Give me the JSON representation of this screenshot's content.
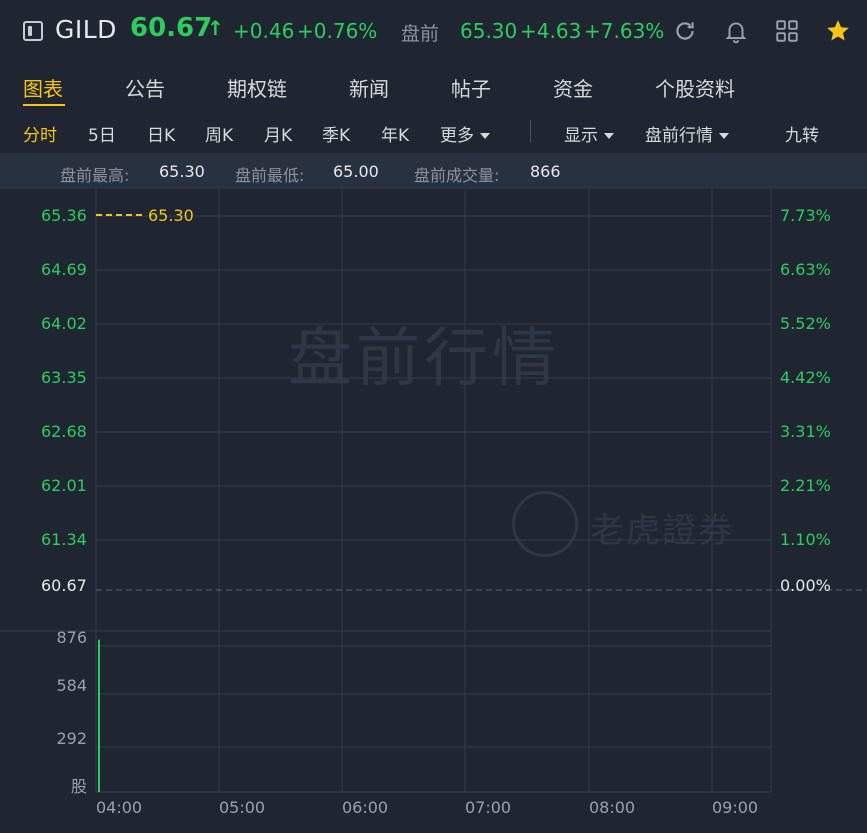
{
  "header": {
    "ticker": "GILD",
    "price": "60.67",
    "arrow": "↑",
    "change": "+0.46",
    "change_pct": "+0.76%",
    "premarket_label": "盘前",
    "premarket_price": "65.30",
    "premarket_change": "+4.63",
    "premarket_pct": "+7.63%",
    "icons": [
      "sidebar-toggle-icon",
      "refresh-icon",
      "bell-icon",
      "grid-icon",
      "star-icon"
    ],
    "accent_color": "#2ecc5e",
    "star_color": "#f5c518"
  },
  "main_tabs": [
    {
      "label": "图表",
      "active": true
    },
    {
      "label": "公告",
      "active": false
    },
    {
      "label": "期权链",
      "active": false
    },
    {
      "label": "新闻",
      "active": false
    },
    {
      "label": "帖子",
      "active": false
    },
    {
      "label": "资金",
      "active": false
    },
    {
      "label": "个股资料",
      "active": false
    }
  ],
  "sub_tabs": {
    "periods": [
      {
        "label": "分时",
        "active": true
      },
      {
        "label": "5日",
        "active": false
      },
      {
        "label": "日K",
        "active": false
      },
      {
        "label": "周K",
        "active": false
      },
      {
        "label": "月K",
        "active": false
      },
      {
        "label": "季K",
        "active": false
      },
      {
        "label": "年K",
        "active": false
      }
    ],
    "more_label": "更多",
    "display_label": "显示",
    "premarket_quote_label": "盘前行情",
    "nine_turn_label": "九转"
  },
  "stats": {
    "high_label": "盘前最高:",
    "high_value": "65.30",
    "low_label": "盘前最低:",
    "low_value": "65.00",
    "volume_label": "盘前成交量:",
    "volume_value": "866"
  },
  "chart_data": {
    "type": "line",
    "price_axis": [
      "65.36",
      "64.69",
      "64.02",
      "63.35",
      "62.68",
      "62.01",
      "61.34",
      "60.67"
    ],
    "pct_axis": [
      "7.73%",
      "6.63%",
      "5.52%",
      "4.42%",
      "3.31%",
      "2.21%",
      "1.10%",
      "0.00%"
    ],
    "ylim": [
      60.67,
      65.36
    ],
    "volume_axis": [
      "876",
      "584",
      "292"
    ],
    "volume_unit": "股",
    "x": [
      "04:00",
      "05:00",
      "06:00",
      "07:00",
      "08:00",
      "09:00"
    ],
    "reference_label": "65.30",
    "reference_value": 65.3,
    "baseline": 60.67,
    "volume_bars": [
      {
        "time": "04:00",
        "volume": 866
      }
    ],
    "watermark": "盘前行情",
    "brand": "老虎證券",
    "grid": true,
    "colors": {
      "up": "#2ecc5e",
      "reference": "#f5c518",
      "grid": "#333c48"
    }
  }
}
